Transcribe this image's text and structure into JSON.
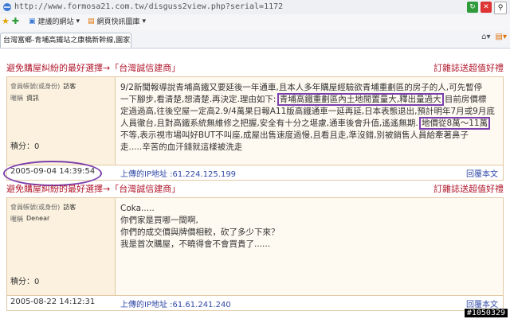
{
  "browser": {
    "url": "http://www.formosa21.com.tw/disguss2view.php?serial=1172",
    "bookmarks": [
      {
        "label": "建議的網站",
        "icon": "star-icon"
      },
      {
        "label": "網頁快訊圖庫",
        "icon": "feed-icon"
      }
    ],
    "tab_title": "台灣富鄉-青埔高鐵站之康橋新幹線,園家..."
  },
  "banners": [
    {
      "left": "避免購屋糾紛的最好選擇→「台灣誠信建商」",
      "right": "訂雜誌送超值好禮"
    },
    {
      "left": "避免購屋糾紛的最好選擇→「台灣誠信建商」",
      "right": "訂雜誌送超值好禮"
    }
  ],
  "posts": [
    {
      "nickname_label": "會員帳號(或身份)",
      "nickname": "訪客",
      "alias_label": "暱稱",
      "alias": "資訊",
      "score": "積分：0",
      "body": [
        "9/2新聞報導說青埔高鐵又要延後一年通車,且本人多年購屋經驗欲青埔重劃區的房子的人,可先暫停",
        "一下腳步,看清楚,想清楚.再決定.理由如下:",
        "青埔高鐵重劃區內土地閒置量大,釋出量過大",
        "目前房價標",
        "定過過高,往後空屋一定高2.9/4萬果日報A11版高鐵通車一延再延,日本表態退出,預計明年7月或9月底",
        "人員徹台,且對高鐵系統無維修之把握,安全有十分之堪慮,通車後會升值,遙遙無期.",
        "地價從8萬～11萬",
        "不等,表示視市場叫好BUT不叫座,成屋出售速度過慢,且看且走,準沒錯,別被銷售人員給牽著鼻子",
        "走.....辛苦的血汗錢就這樣被洗走"
      ],
      "date": "2005-09-04 14:39:54",
      "ip": "上傳的IP地址 :61.224.125.199",
      "reply": "回覆本文"
    },
    {
      "nickname_label": "會員帳號(或身份)",
      "nickname": "訪客",
      "alias_label": "暱稱",
      "alias": "Denear",
      "score": "積分：0",
      "body": [
        "Coka.....",
        "你們家是買哪一間啊,",
        "你們的成交價與牌價相較，砍了多少下來？",
        "我是首次購屋，不曉得會不會買貴了......"
      ],
      "date": "2005-08-22 14:12:31",
      "ip": "上傳的IP地址 :61.61.241.240",
      "reply": "回覆本文"
    }
  ],
  "watermark": "#1050329"
}
